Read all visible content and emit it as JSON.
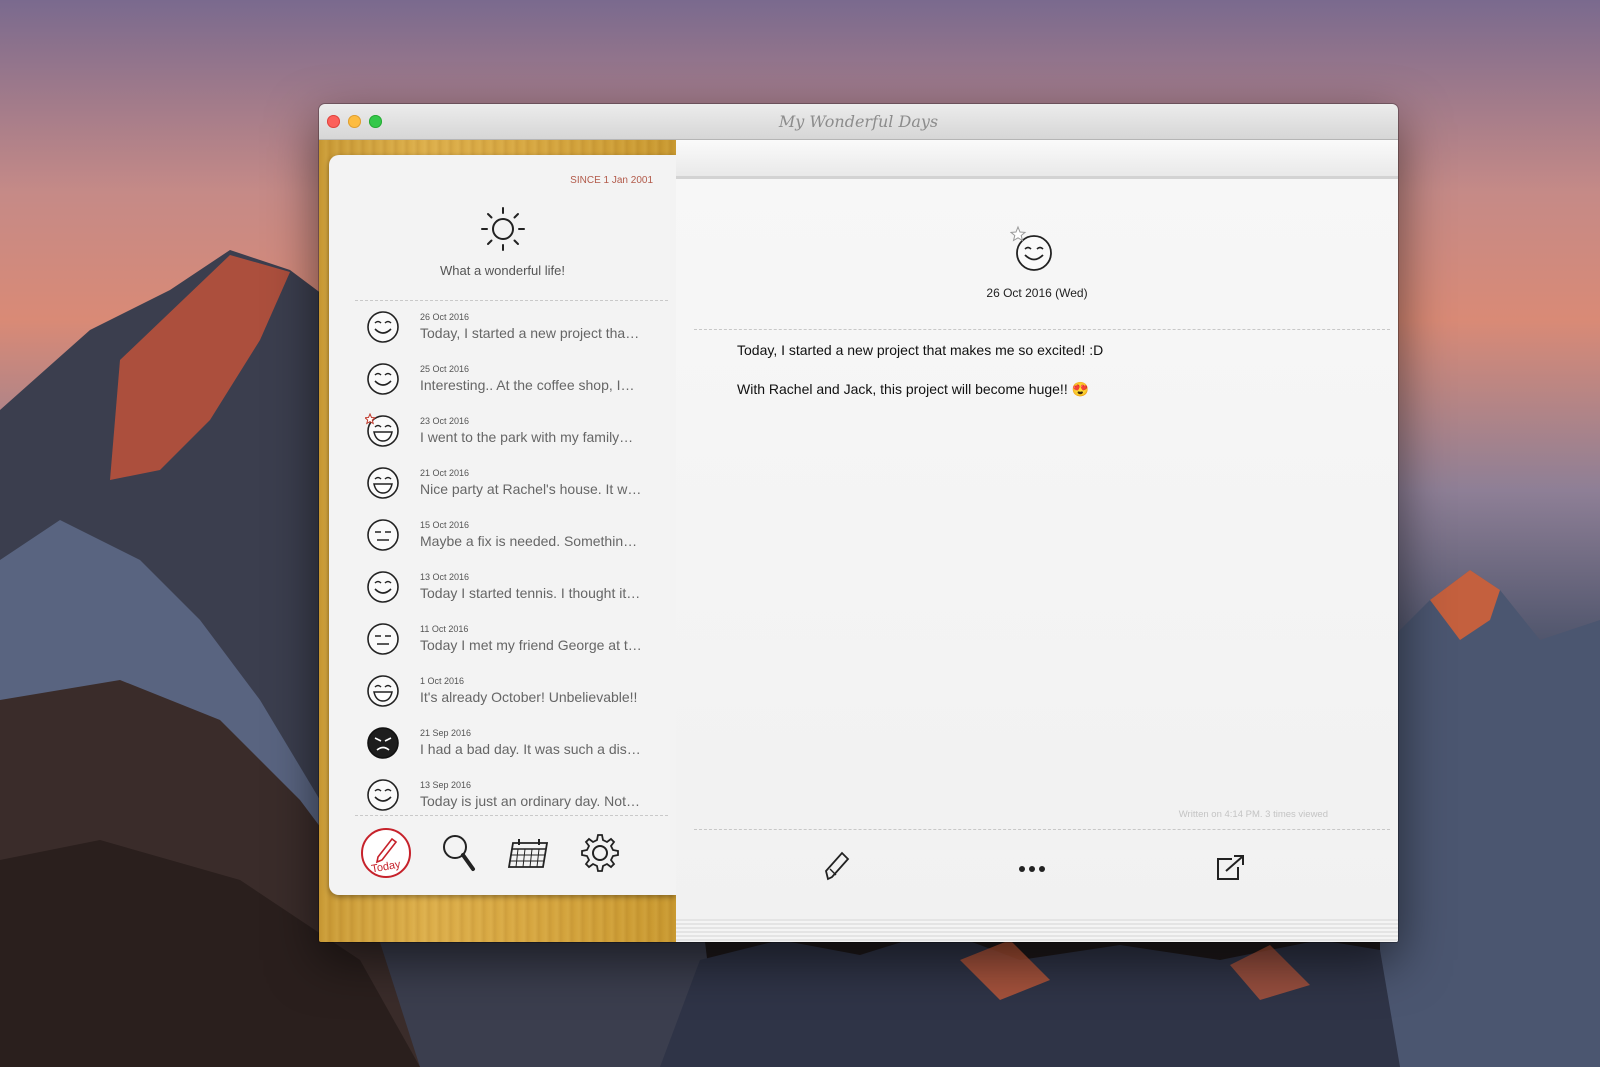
{
  "window": {
    "title": "My Wonderful Days"
  },
  "sidebar": {
    "since": "SINCE 1 Jan 2001",
    "motto": "What a wonderful life!",
    "entries": [
      {
        "date": "26 Oct 2016",
        "text": "Today, I started a new project tha…",
        "mood": "smile-icon"
      },
      {
        "date": "25 Oct 2016",
        "text": "Interesting.. At the coffee shop, I…",
        "mood": "smile-icon"
      },
      {
        "date": "23 Oct 2016",
        "text": "I went to the park with my family…",
        "mood": "grin-star-icon"
      },
      {
        "date": "21 Oct 2016",
        "text": "Nice party at Rachel's house. It w…",
        "mood": "grin-icon"
      },
      {
        "date": "15 Oct 2016",
        "text": "Maybe a fix is needed. Somethin…",
        "mood": "meh-icon"
      },
      {
        "date": "13 Oct 2016",
        "text": "Today I started tennis. I thought it…",
        "mood": "smile-icon"
      },
      {
        "date": "11 Oct 2016",
        "text": "Today I met my friend George at t…",
        "mood": "meh-icon"
      },
      {
        "date": "1 Oct 2016",
        "text": "It's already October! Unbelievable!!",
        "mood": "grin-icon"
      },
      {
        "date": "21 Sep 2016",
        "text": "I had a bad day. It was such a dis…",
        "mood": "angry-icon"
      },
      {
        "date": "13 Sep 2016",
        "text": "Today is just an ordinary day. Not…",
        "mood": "smile-icon"
      }
    ],
    "toolbar": {
      "today_label": "Today"
    }
  },
  "detail": {
    "date": "26 Oct 2016 (Wed)",
    "line1": "Today, I started a new project that makes me so excited! :D",
    "line2": "With Rachel and Jack, this project will become huge!! 😍",
    "meta": "Written on 4:14 PM. 3 times viewed"
  }
}
